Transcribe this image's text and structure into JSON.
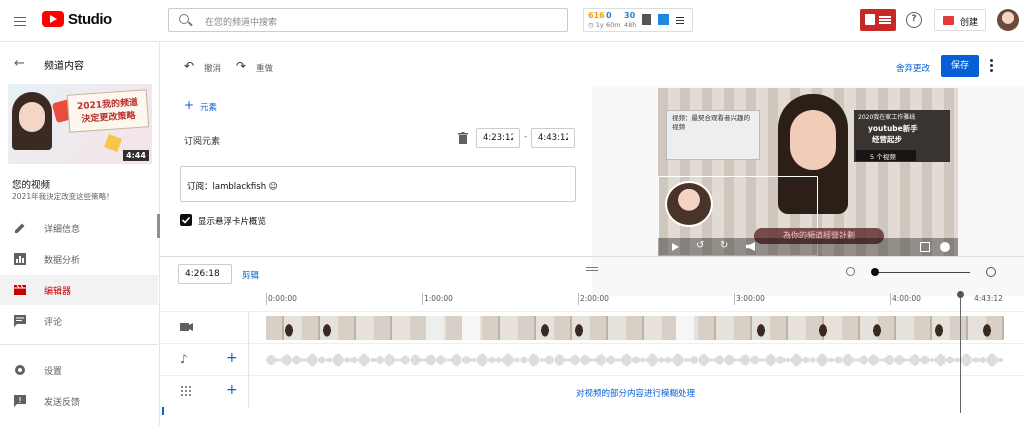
{
  "header": {
    "app_name": "Studio",
    "search_placeholder": "在您的频道中搜索",
    "ext": {
      "n1": "616",
      "n2": "0",
      "n3": "30",
      "l1": "1y",
      "l2": "60m",
      "l3": "48h"
    },
    "create_label": "创建"
  },
  "sidebar": {
    "back_title": "频道内容",
    "video_duration": "4:44",
    "thumb_caption_line1": "2021我的频道",
    "thumb_caption_line2": "決定更改策略",
    "your_video_label": "您的视频",
    "video_title": "2021年我決定改变这些策略！",
    "items": [
      {
        "label": "详细信息",
        "icon": "pencil-icon"
      },
      {
        "label": "数据分析",
        "icon": "analytics-icon"
      },
      {
        "label": "编辑器",
        "icon": "editor-icon",
        "active": true
      },
      {
        "label": "评论",
        "icon": "comments-icon"
      },
      {
        "label": "设置",
        "icon": "gear-icon"
      },
      {
        "label": "发送反馈",
        "icon": "feedback-icon"
      }
    ]
  },
  "toolbar": {
    "undo_label": "撤消",
    "redo_label": "重做",
    "discard_label": "舍弃更改",
    "save_label": "保存"
  },
  "panel": {
    "add_element_label": "元素",
    "subscribe_element_label": "订阅元素",
    "start_time": "4:23:12",
    "end_time": "4:43:12",
    "subscribe_value": "订阅：lamblackfish ☺",
    "show_hover_label": "显示悬浮卡片概览"
  },
  "preview": {
    "card_left_text": "视频：最契合观看者兴趣的视频",
    "card_right_title": "2020我在家工作雅线",
    "card_right_sub1": "youtube新手",
    "card_right_sub2": "经营起步",
    "card_right_count": "5 个视频",
    "subtitle": "為你的頻道經營計劃"
  },
  "timeline": {
    "current_time": "4:26:18",
    "trim_label": "剪辑",
    "ruler": [
      "0:00:00",
      "1:00:00",
      "2:00:00",
      "3:00:00",
      "4:00:00",
      "4:43:12"
    ],
    "blur_label": "对视频的部分内容进行模糊处理"
  },
  "colors": {
    "brand_red": "#ff0000",
    "primary_blue": "#065fd4",
    "active_red": "#cc0000"
  }
}
